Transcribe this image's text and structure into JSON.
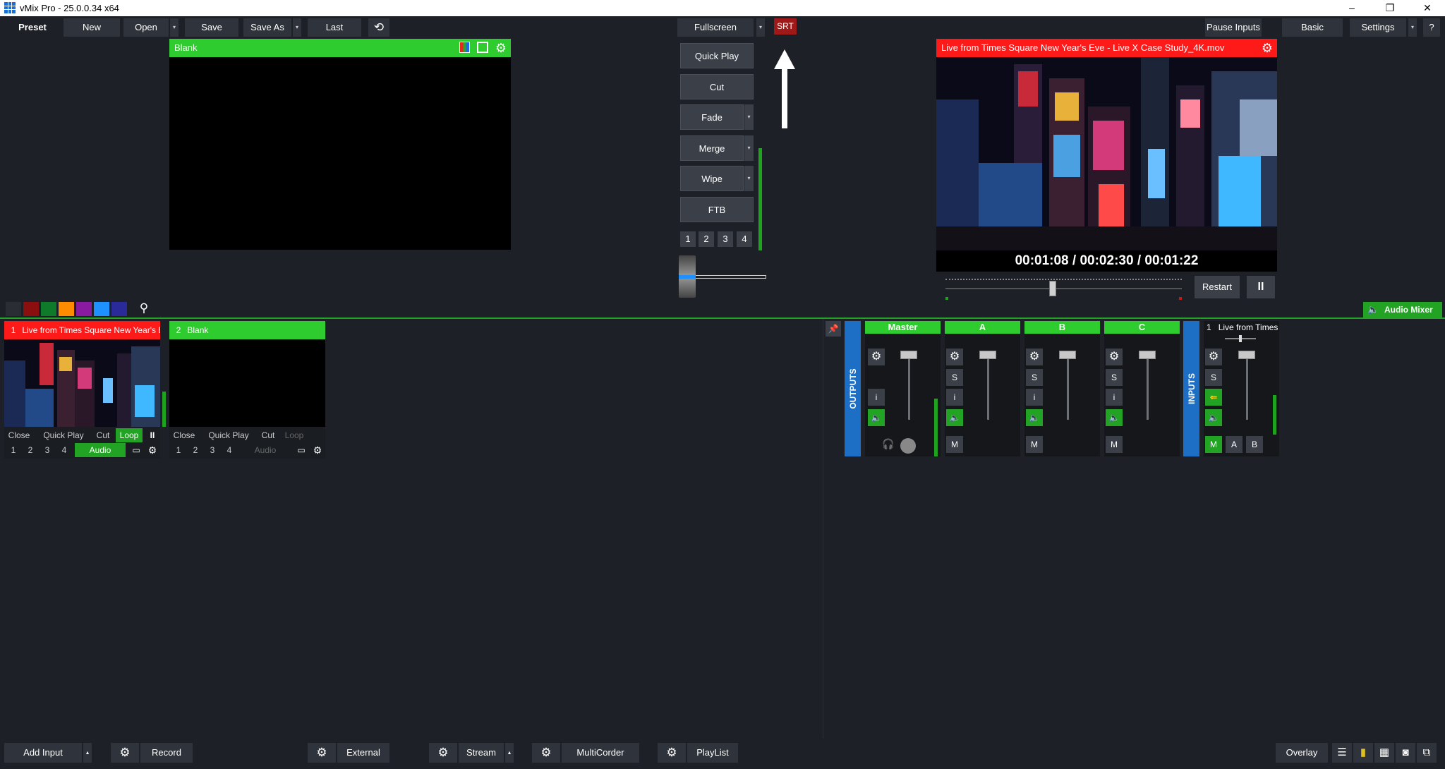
{
  "window": {
    "title": "vMix Pro - 25.0.0.34 x64",
    "minimize": "–",
    "restore": "❐",
    "close": "✕"
  },
  "toolbar": {
    "preset": "Preset",
    "new": "New",
    "open": "Open",
    "save": "Save",
    "save_as": "Save As",
    "last": "Last",
    "fullscreen": "Fullscreen",
    "srt": "SRT",
    "pause_inputs": "Pause Inputs",
    "basic": "Basic",
    "settings": "Settings",
    "help": "?"
  },
  "preview": {
    "title": "Blank"
  },
  "transitions": {
    "quick_play": "Quick Play",
    "cut": "Cut",
    "fade": "Fade",
    "merge": "Merge",
    "wipe": "Wipe",
    "ftb": "FTB",
    "numbers": [
      "1",
      "2",
      "3",
      "4"
    ]
  },
  "output": {
    "title": "Live from Times Square New Year's Eve - Live X Case Study_4K.mov",
    "position": "00:01:08",
    "duration": "00:02:30",
    "remaining": "00:01:22",
    "sep": "/",
    "progress": 0.453,
    "restart": "Restart",
    "pause": "II"
  },
  "color_filters": [
    "#2a2d33",
    "#8b0f0f",
    "#0f7a2a",
    "#ff8c00",
    "#8a1aa0",
    "#1e90ff",
    "#2a2a9a"
  ],
  "inputs": [
    {
      "number": "1",
      "title": "Live from Times Square New Year's E",
      "head_color": "#ff1a1a",
      "close": "Close",
      "quick_play": "Quick Play",
      "cut": "Cut",
      "loop": "Loop",
      "audio": "Audio"
    },
    {
      "number": "2",
      "title": "Blank",
      "head_color": "#2ecc2e",
      "close": "Close",
      "quick_play": "Quick Play",
      "cut": "Cut",
      "loop": "Loop",
      "audio": "Audio"
    }
  ],
  "input_numbers": [
    "1",
    "2",
    "3",
    "4"
  ],
  "audio_mixer": {
    "label": "Audio Mixer",
    "outputs_label": "OUTPUTS",
    "inputs_label": "INPUTS",
    "strips": [
      "Master",
      "A",
      "B",
      "C"
    ],
    "input_strip": {
      "number": "1",
      "title": "Live from Times"
    },
    "s": "S",
    "i": "i",
    "m": "M",
    "a": "A",
    "b": "B"
  },
  "bottom": {
    "add_input": "Add Input",
    "record": "Record",
    "external": "External",
    "stream": "Stream",
    "multicorder": "MultiCorder",
    "playlist": "PlayList",
    "overlay": "Overlay"
  },
  "icons": [
    "vmix-logo-icon",
    "gear-icon",
    "refresh-icon",
    "search-icon",
    "speaker-icon",
    "headphones-icon",
    "pin-icon",
    "pause-icon",
    "monitor-icon",
    "list-icon",
    "meter-icon",
    "grid-icon",
    "camera-icon",
    "arrow-up-icon"
  ]
}
